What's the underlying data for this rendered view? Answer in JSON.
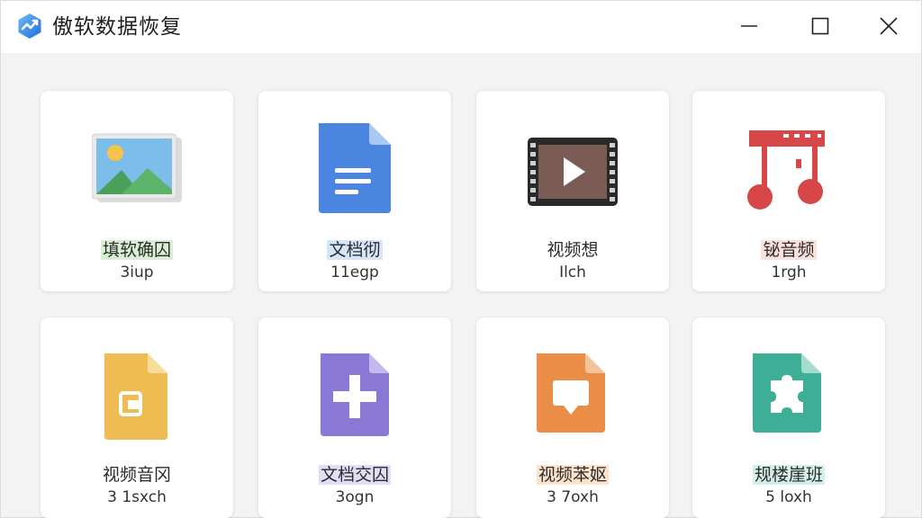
{
  "window": {
    "title": "傲软数据恢复",
    "logo_icon": "app-logo-icon",
    "controls": [
      "minimize-icon",
      "maximize-icon",
      "close-icon"
    ]
  },
  "cards": [
    {
      "label": "填软确囚",
      "sub": "3iup",
      "icon": "image-icon",
      "highlight": "#d8f0d2"
    },
    {
      "label": "文档彻",
      "sub": "11egp",
      "icon": "document-icon",
      "highlight": "#d6e6fa"
    },
    {
      "label": "视频想",
      "sub": "Ilch",
      "icon": "video-icon",
      "highlight": ""
    },
    {
      "label": "铋音频",
      "sub": "1rgh",
      "icon": "music-icon",
      "highlight": "#fbe1de"
    },
    {
      "label": "视频音冈",
      "sub": "3 1sxch",
      "icon": "archive-icon",
      "highlight": ""
    },
    {
      "label": "文档交囚",
      "sub": "3ogn",
      "icon": "other-file-icon",
      "highlight": "#e3def7"
    },
    {
      "label": "视频苯妪",
      "sub": "3 7oxh",
      "icon": "presentation-icon",
      "highlight": "#fde3cc"
    },
    {
      "label": "规楼崖班",
      "sub": "5 loxh",
      "icon": "puzzle-icon",
      "highlight": "#d3efe9"
    }
  ],
  "colors": {
    "accent": "#2f7de1",
    "image_blue": "#6fb3e6",
    "document_blue": "#4a86e0",
    "video_brown": "#7a5c55",
    "music_red": "#d84747",
    "archive_yellow": "#eebc52",
    "other_purple": "#8a78d6",
    "presentation_orange": "#e98d47",
    "puzzle_teal": "#3fae96"
  }
}
